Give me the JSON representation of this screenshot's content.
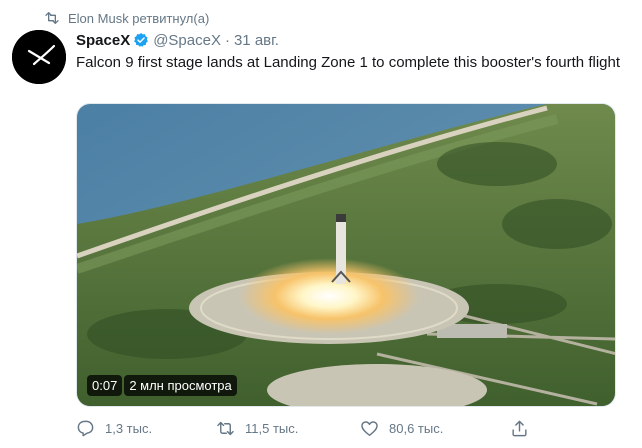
{
  "retweet_context": {
    "icon": "retweet-icon",
    "text": "Elon Musk ретвитнул(а)"
  },
  "tweet": {
    "author": {
      "display_name": "SpaceX",
      "handle": "@SpaceX",
      "verified_icon": "verified-badge-icon",
      "avatar_icon": "spacex-logo-icon"
    },
    "separator": "·",
    "time": "31 авг.",
    "text": "Falcon 9 first stage lands at Landing Zone 1 to complete this booster's fourth flight",
    "media": {
      "type": "video",
      "duration": "0:07",
      "views": "2 млн просмотра"
    },
    "actions": {
      "reply_count": "1,3 тыс.",
      "retweet_count": "11,5 тыс.",
      "like_count": "80,6 тыс."
    }
  },
  "colors": {
    "accent": "#1da1f2",
    "muted": "#657786",
    "text": "#14171a"
  }
}
